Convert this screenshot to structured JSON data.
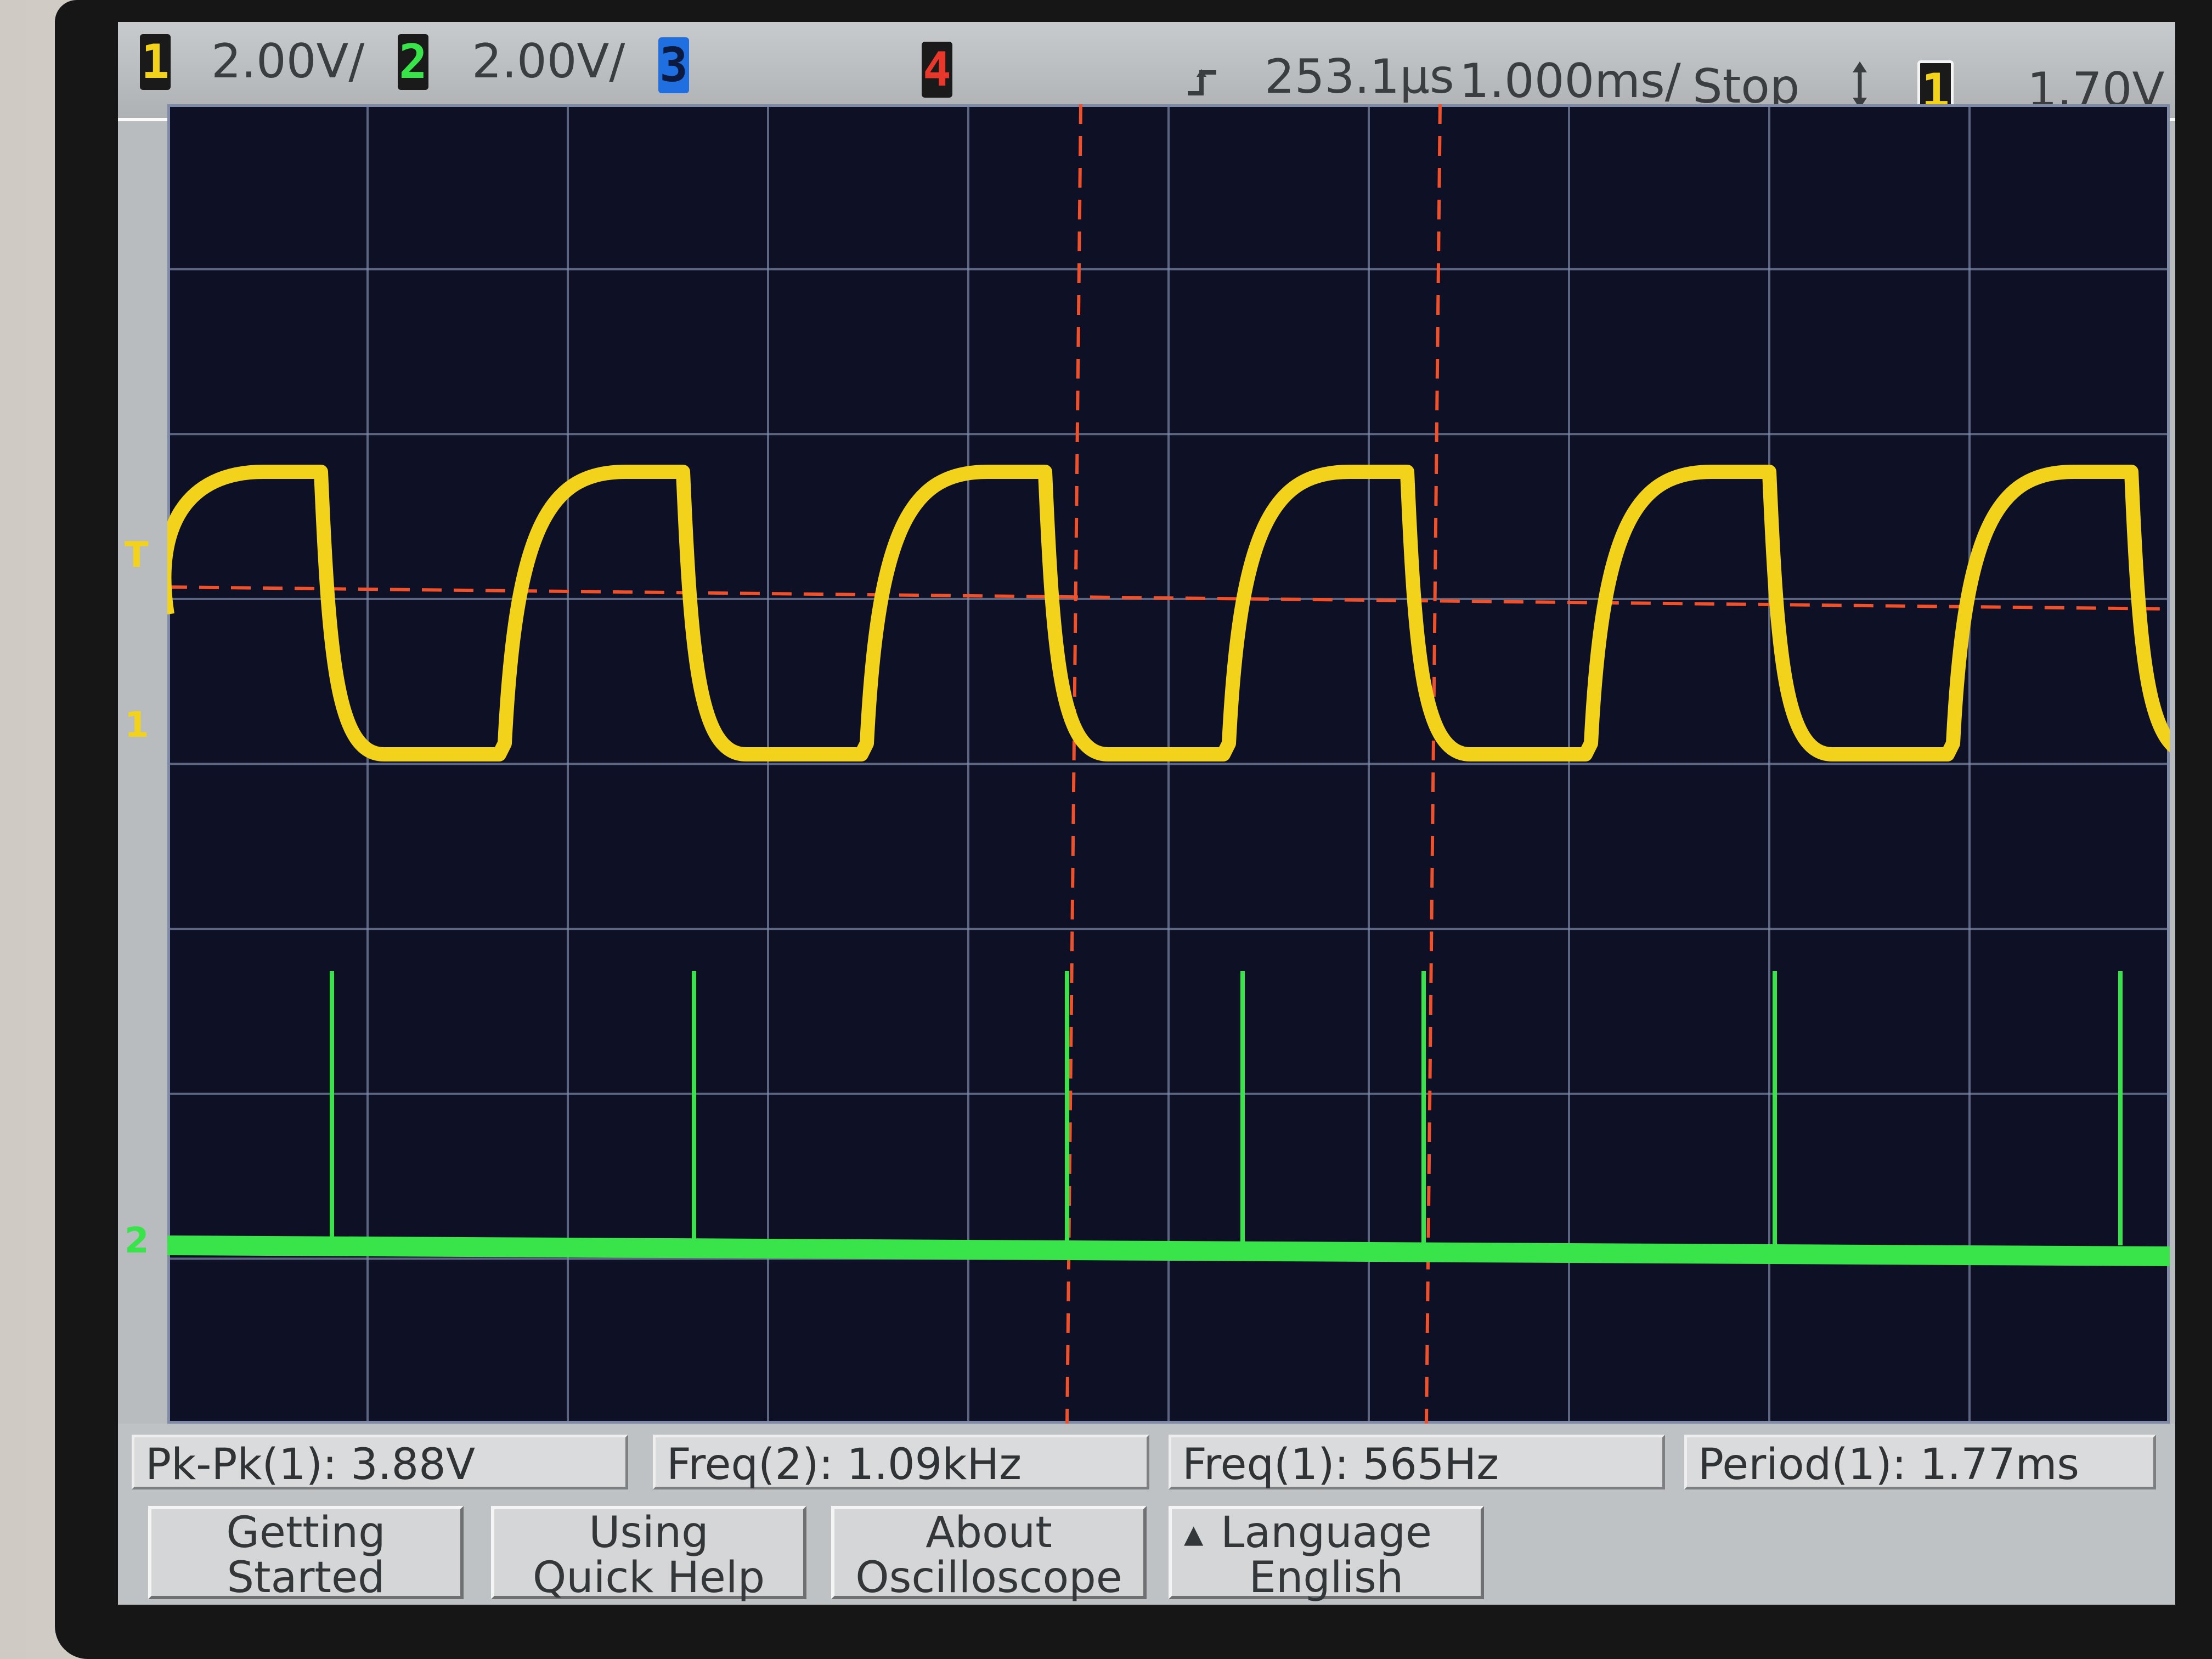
{
  "top_bar": {
    "ch1": {
      "badge": "1",
      "scale": "2.00V/",
      "color": "#f2d21b"
    },
    "ch2": {
      "badge": "2",
      "scale": "2.00V/",
      "color": "#39e34a"
    },
    "ch3": {
      "badge": "3",
      "color": "#1f6fe0"
    },
    "ch4": {
      "badge": "4",
      "color": "#e8382c"
    },
    "trigger_icon": "trigger-edge-icon",
    "time_delay": "253.1µs",
    "time_scale": "1.000ms/",
    "run_state": "Stop",
    "trigger_source_badge": "1",
    "trigger_level": "1.70V"
  },
  "markers": {
    "trigger_level": "T",
    "ch1_ground": "1",
    "ch2_ground": "2"
  },
  "measurements": {
    "pkpk": "Pk-Pk(1): 3.88V",
    "freq2": "Freq(2): 1.09kHz",
    "freq1": "Freq(1): 565Hz",
    "period1": "Period(1): 1.77ms"
  },
  "softkeys": {
    "getting_started": [
      "Getting",
      "Started"
    ],
    "quick_help": [
      "Using",
      "Quick Help"
    ],
    "about": [
      "About",
      "Oscilloscope"
    ],
    "language": [
      "Language",
      "English"
    ]
  },
  "trace_colors": {
    "ch1": "#f2d21b",
    "ch2": "#39e34a",
    "cursor": "#f0502a",
    "grid": "#7f8aa8"
  }
}
